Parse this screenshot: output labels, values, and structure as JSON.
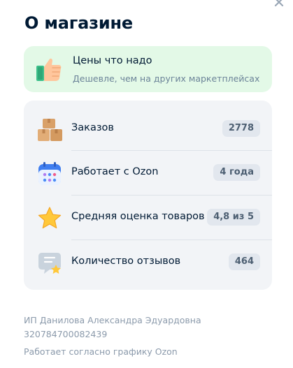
{
  "title": "О магазине",
  "promo": {
    "title": "Цены что надо",
    "subtitle": "Дешевле, чем на других маркетплейсах",
    "icon": "thumbs-up-icon"
  },
  "stats": [
    {
      "label": "Заказов",
      "value": "2778",
      "icon": "boxes-icon"
    },
    {
      "label": "Работает с Ozon",
      "value": "4 года",
      "icon": "calendar-icon"
    },
    {
      "label": "Средняя оценка товаров",
      "value": "4,8 из 5",
      "icon": "star-icon"
    },
    {
      "label": "Количество отзывов",
      "value": "464",
      "icon": "review-icon"
    }
  ],
  "footer": {
    "seller_name": "ИП Данилова Александра Эдуардовна",
    "ogrn": "320784700082439",
    "schedule": "Работает согласно графику Ozon"
  },
  "colors": {
    "promo_bg": "#e3f9e7",
    "card_bg": "#f2f4f7",
    "badge_bg": "#e2e7ee",
    "muted_text": "#8b9aab"
  }
}
